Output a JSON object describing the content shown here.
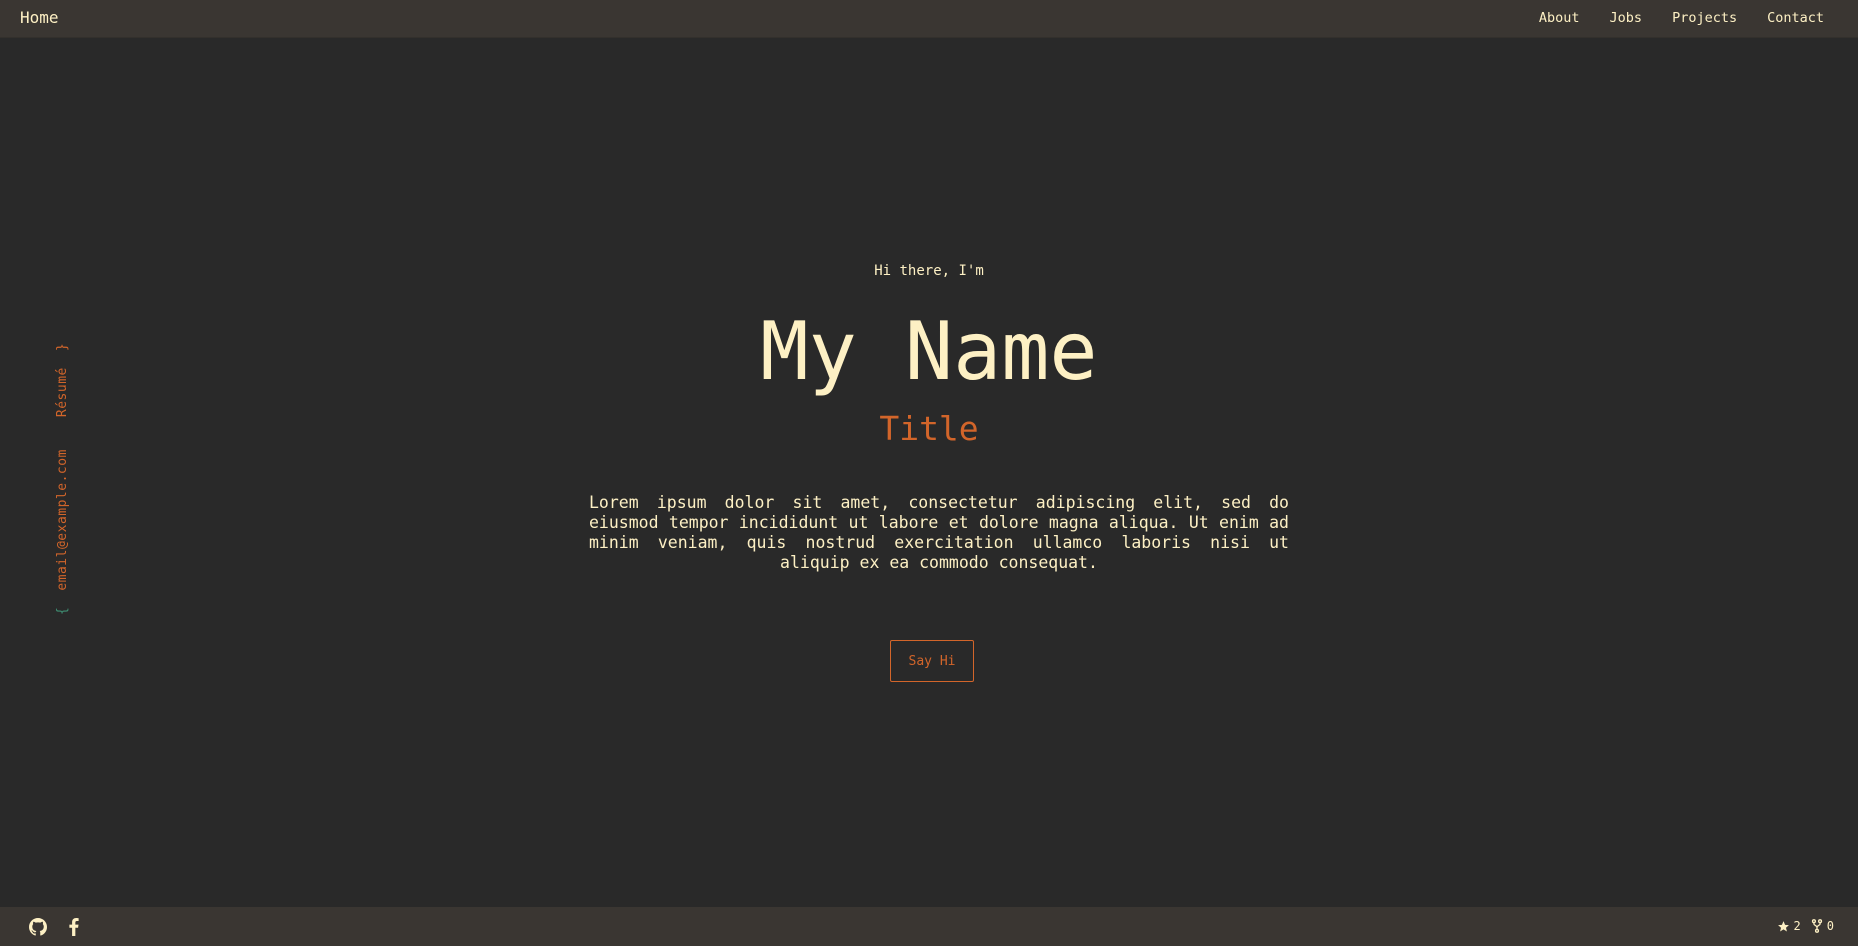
{
  "nav": {
    "home_label": "Home",
    "links": [
      {
        "label": "About"
      },
      {
        "label": "Jobs"
      },
      {
        "label": "Projects"
      },
      {
        "label": "Contact"
      }
    ]
  },
  "side": {
    "brace_open": "{",
    "email": "email@example.com",
    "resume": "Résumé",
    "brace_close": "}"
  },
  "hero": {
    "greeting": "Hi there, I'm",
    "name": "My Name",
    "title": "Title",
    "bio": "Lorem ipsum dolor sit amet, consectetur adipiscing elit, sed do eiusmod tempor incididunt ut labore et dolore magna aliqua. Ut enim ad minim veniam, quis nostrud exercitation ullamco laboris nisi ut aliquip ex ea commodo consequat.",
    "cta_label": "Say Hi"
  },
  "footer": {
    "social_icons": [
      "github-icon",
      "facebook-icon"
    ],
    "stars": "2",
    "forks": "0"
  },
  "colors": {
    "background": "#292929",
    "bar": "#3a3632",
    "text": "#fdf0c4",
    "accent": "#d2652a",
    "brace_accent": "#3f8f73"
  }
}
